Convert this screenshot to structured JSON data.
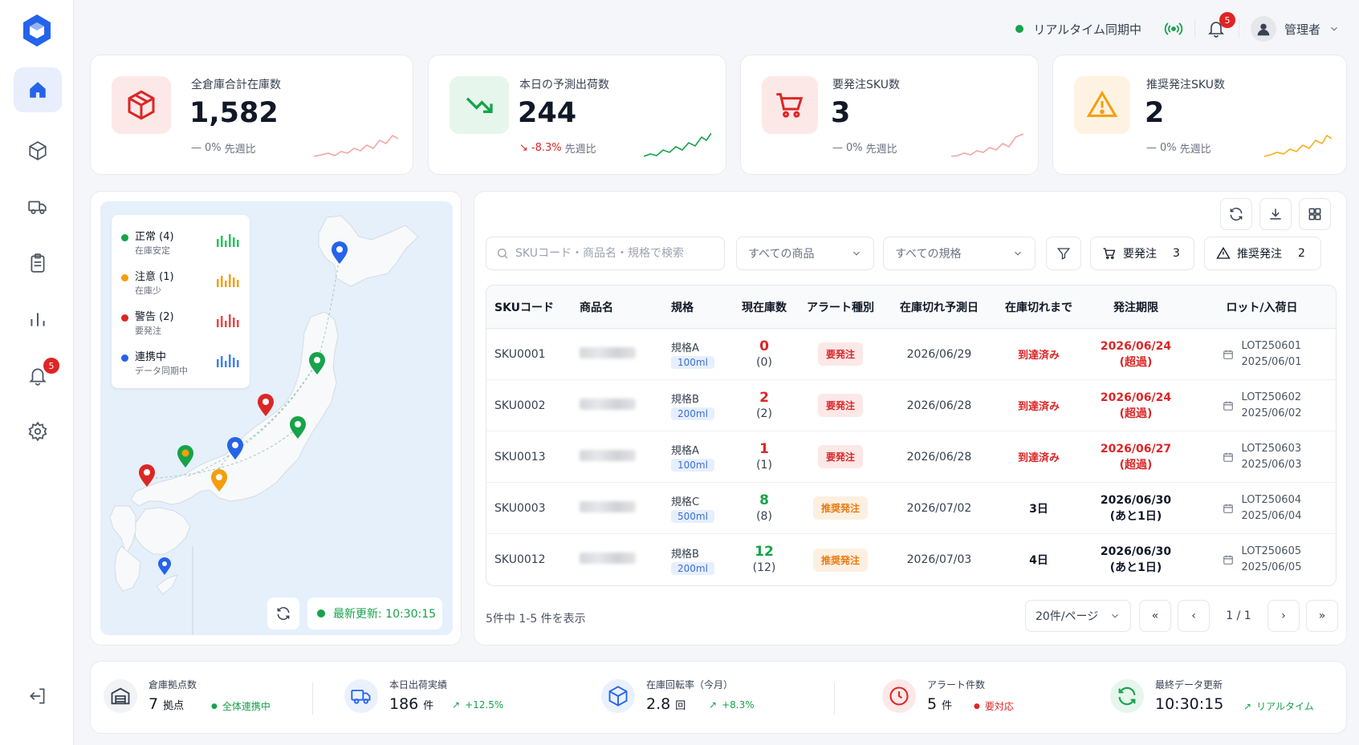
{
  "sidebar": {
    "badge_alerts": "5"
  },
  "header": {
    "sync_label": "リアルタイム同期中",
    "notif_count": "5",
    "user_name": "管理者"
  },
  "kpis": [
    {
      "label": "全倉庫合計在庫数",
      "value": "1,582",
      "trend_symbol": "—",
      "trend_value": "0%",
      "trend_suffix": "先週比",
      "color": "#ef4444",
      "bg": "#fde8e8"
    },
    {
      "label": "本日の予測出荷数",
      "value": "244",
      "trend_symbol": "↘",
      "trend_value": "-8.3%",
      "trend_suffix": "先週比",
      "color": "#16a34a",
      "bg": "#e6f6ec"
    },
    {
      "label": "要発注SKU数",
      "value": "3",
      "trend_symbol": "—",
      "trend_value": "0%",
      "trend_suffix": "先週比",
      "color": "#ef4444",
      "bg": "#fde8e8"
    },
    {
      "label": "推奨発注SKU数",
      "value": "2",
      "trend_symbol": "—",
      "trend_value": "0%",
      "trend_suffix": "先週比",
      "color": "#f59e0b",
      "bg": "#fef3e2"
    }
  ],
  "map": {
    "legend": [
      {
        "name": "正常",
        "count": "(4)",
        "sub": "在庫安定",
        "color": "#16a34a"
      },
      {
        "name": "注意",
        "count": "(1)",
        "sub": "在庫少",
        "color": "#f59e0b"
      },
      {
        "name": "警告",
        "count": "(2)",
        "sub": "要発注",
        "color": "#dc2626"
      },
      {
        "name": "連携中",
        "count": "",
        "sub": "データ同期中",
        "color": "#2563eb"
      }
    ],
    "update_label": "最新更新: 10:30:15"
  },
  "table": {
    "search_placeholder": "SKUコード・商品名・規格で検索",
    "filter_product": "すべての商品",
    "filter_spec": "すべての規格",
    "btn_order": "要発注",
    "btn_order_count": "3",
    "btn_recommend": "推奨発注",
    "btn_recommend_count": "2",
    "headers": [
      "SKUコード",
      "商品名",
      "規格",
      "現在庫数",
      "アラート種別",
      "在庫切れ予測日",
      "在庫切れまで",
      "発注期限",
      "ロット/入荷日"
    ],
    "rows": [
      {
        "sku": "SKU0001",
        "spec": "規格A",
        "vol": "100ml",
        "stock": "0",
        "stock_paren": "(0)",
        "alert": "要発注",
        "predict": "2026/06/29",
        "until": "到達済み",
        "deadline": "2026/06/24",
        "deadline_note": "(超過)",
        "lot": "LOT250601",
        "lot_date": "2025/06/01"
      },
      {
        "sku": "SKU0002",
        "spec": "規格B",
        "vol": "200ml",
        "stock": "2",
        "stock_paren": "(2)",
        "alert": "要発注",
        "predict": "2026/06/28",
        "until": "到達済み",
        "deadline": "2026/06/24",
        "deadline_note": "(超過)",
        "lot": "LOT250602",
        "lot_date": "2025/06/02"
      },
      {
        "sku": "SKU0013",
        "spec": "規格A",
        "vol": "100ml",
        "stock": "1",
        "stock_paren": "(1)",
        "alert": "要発注",
        "predict": "2026/06/28",
        "until": "到達済み",
        "deadline": "2026/06/27",
        "deadline_note": "(超過)",
        "lot": "LOT250603",
        "lot_date": "2025/06/03"
      },
      {
        "sku": "SKU0003",
        "spec": "規格C",
        "vol": "500ml",
        "stock": "8",
        "stock_paren": "(8)",
        "alert": "推奨発注",
        "predict": "2026/07/02",
        "until": "3日",
        "deadline": "2026/06/30",
        "deadline_note": "(あと1日)",
        "lot": "LOT250604",
        "lot_date": "2025/06/04"
      },
      {
        "sku": "SKU0012",
        "spec": "規格B",
        "vol": "200ml",
        "stock": "12",
        "stock_paren": "(12)",
        "alert": "推奨発注",
        "predict": "2026/07/03",
        "until": "4日",
        "deadline": "2026/06/30",
        "deadline_note": "(あと1日)",
        "lot": "LOT250605",
        "lot_date": "2025/06/05"
      }
    ],
    "pagination_info": "5件中 1-5 件を表示",
    "page_size": "20件/ページ",
    "page_indicator": "1 / 1",
    "first": "«",
    "prev": "‹",
    "next": "›",
    "last": "»"
  },
  "bottom_stats": [
    {
      "label": "倉庫拠点数",
      "value": "7",
      "unit": "拠点",
      "note": "全体連携中",
      "note_symbol": "●",
      "note_color": "#16a34a"
    },
    {
      "label": "本日出荷実績",
      "value": "186",
      "unit": "件",
      "note": "+12.5%",
      "note_symbol": "↗",
      "note_color": "#16a34a"
    },
    {
      "label": "在庫回転率（今月）",
      "value": "2.8",
      "unit": "回",
      "note": "+8.3%",
      "note_symbol": "↗",
      "note_color": "#16a34a"
    },
    {
      "label": "アラート件数",
      "value": "5",
      "unit": "件",
      "note": "要対応",
      "note_symbol": "●",
      "note_color": "#dc2626"
    },
    {
      "label": "最終データ更新",
      "value": "10:30:15",
      "unit": "",
      "note": "リアルタイム",
      "note_symbol": "↗",
      "note_color": "#16a34a"
    }
  ]
}
